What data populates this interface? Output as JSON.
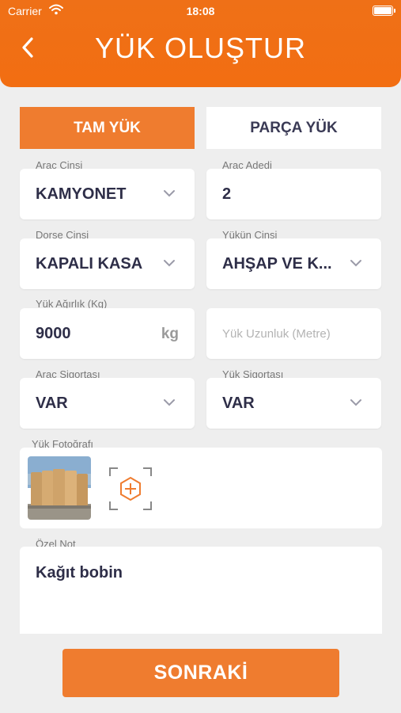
{
  "status_bar": {
    "carrier": "Carrier",
    "time": "18:08"
  },
  "header": {
    "title": "YÜK OLUŞTUR"
  },
  "tabs": {
    "full": "TAM YÜK",
    "partial": "PARÇA YÜK",
    "selected": "full"
  },
  "form": {
    "vehicle_type": {
      "label": "Araç Cinsi",
      "value": "KAMYONET"
    },
    "vehicle_count": {
      "label": "Araç Adedi",
      "value": "2"
    },
    "trailer_type": {
      "label": "Dorse Cinsi",
      "value": "KAPALI KASA"
    },
    "cargo_type": {
      "label": "Yükün Cinsi",
      "value": "AHŞAP VE K..."
    },
    "cargo_weight": {
      "label": "Yük Ağırlık (Kg)",
      "value": "9000",
      "unit": "kg"
    },
    "cargo_length": {
      "placeholder": "Yük Uzunluk (Metre)"
    },
    "vehicle_insurance": {
      "label": "Araç Sigortası",
      "value": "VAR"
    },
    "cargo_insurance": {
      "label": "Yük Sigortası",
      "value": "VAR"
    },
    "photo": {
      "label": "Yük Fotoğrafı"
    },
    "note": {
      "label": "Özel Not",
      "value": "Kağıt bobin"
    }
  },
  "actions": {
    "next": "SONRAKİ"
  },
  "icons": {
    "back": "chevron-left-icon",
    "dropdown": "chevron-down-icon",
    "add_photo": "add-photo-icon",
    "wifi": "wifi-icon",
    "battery": "battery-icon"
  },
  "colors": {
    "accent": "#ef7c2f",
    "header": "#f26e12",
    "text_dark": "#2e2e48",
    "background": "#eeeeee"
  }
}
